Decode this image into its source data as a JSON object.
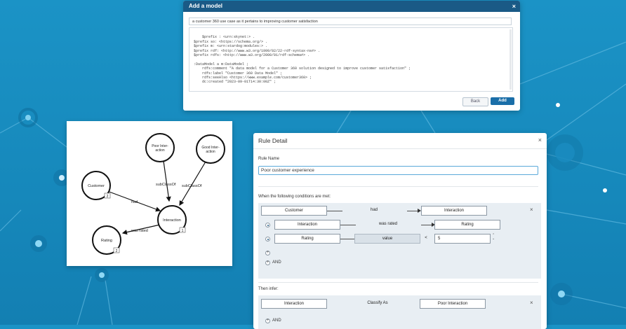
{
  "add_model": {
    "title": "Add a model",
    "close": "×",
    "prompt": "a customer 360 use case as it pertains to improving customer satisfaction",
    "code": "$prefix : <urn:skynet:> .\n$prefix so: <https://schema.org/> .\n$prefix m: <urn:stardog:modules:> .\n$prefix rdf: <http://www.w3.org/1999/02/22-rdf-syntax-ns#> .\n$prefix rdfs: <http://www.w3.org/2000/01/rdf-schema#> .\n\n:DataModel a m:DataModel ;\n    rdfs:comment \"A data model for a Customer 360 solution designed to improve customer satisfaction\" ;\n    rdfs:label \"Customer 360 Data Model\" ;\n    rdfs:seeAlso <https://www.example.com/customer360> ;\n    dc:created \"2023-09-01T14:30:00Z\" ;",
    "back_label": "Back",
    "add_label": "Add"
  },
  "graph": {
    "nodes": {
      "poor": "Poor Inter-\naction",
      "good": "Good Inter-\naction",
      "customer": "Customer",
      "interaction": "Interaction",
      "rating": "Rating"
    },
    "badges": {
      "customer": "2",
      "interaction": "1",
      "rating": "2"
    },
    "edges": {
      "subclass1": "subClassOf",
      "subclass2": "subClassOf",
      "had": "had",
      "was_rated": "was rated"
    }
  },
  "rule": {
    "title": "Rule Detail",
    "close": "×",
    "name_label": "Rule Name",
    "name_value": "Poor customer experience",
    "conditions_label": "When the following conditions are met:",
    "c1": {
      "subject": "Customer",
      "predicate": "had",
      "object": "Interaction"
    },
    "c2": {
      "subject": "Interaction",
      "predicate": "was rated",
      "object": "Rating"
    },
    "c3": {
      "subject": "Rating",
      "predicate": "value",
      "operator": "<",
      "value": "5"
    },
    "and_label": "AND",
    "then_label": "Then infer:",
    "infer": {
      "subject": "Interaction",
      "predicate": "Classify As",
      "object": "Poor Interaction"
    },
    "and_label2": "AND"
  }
}
